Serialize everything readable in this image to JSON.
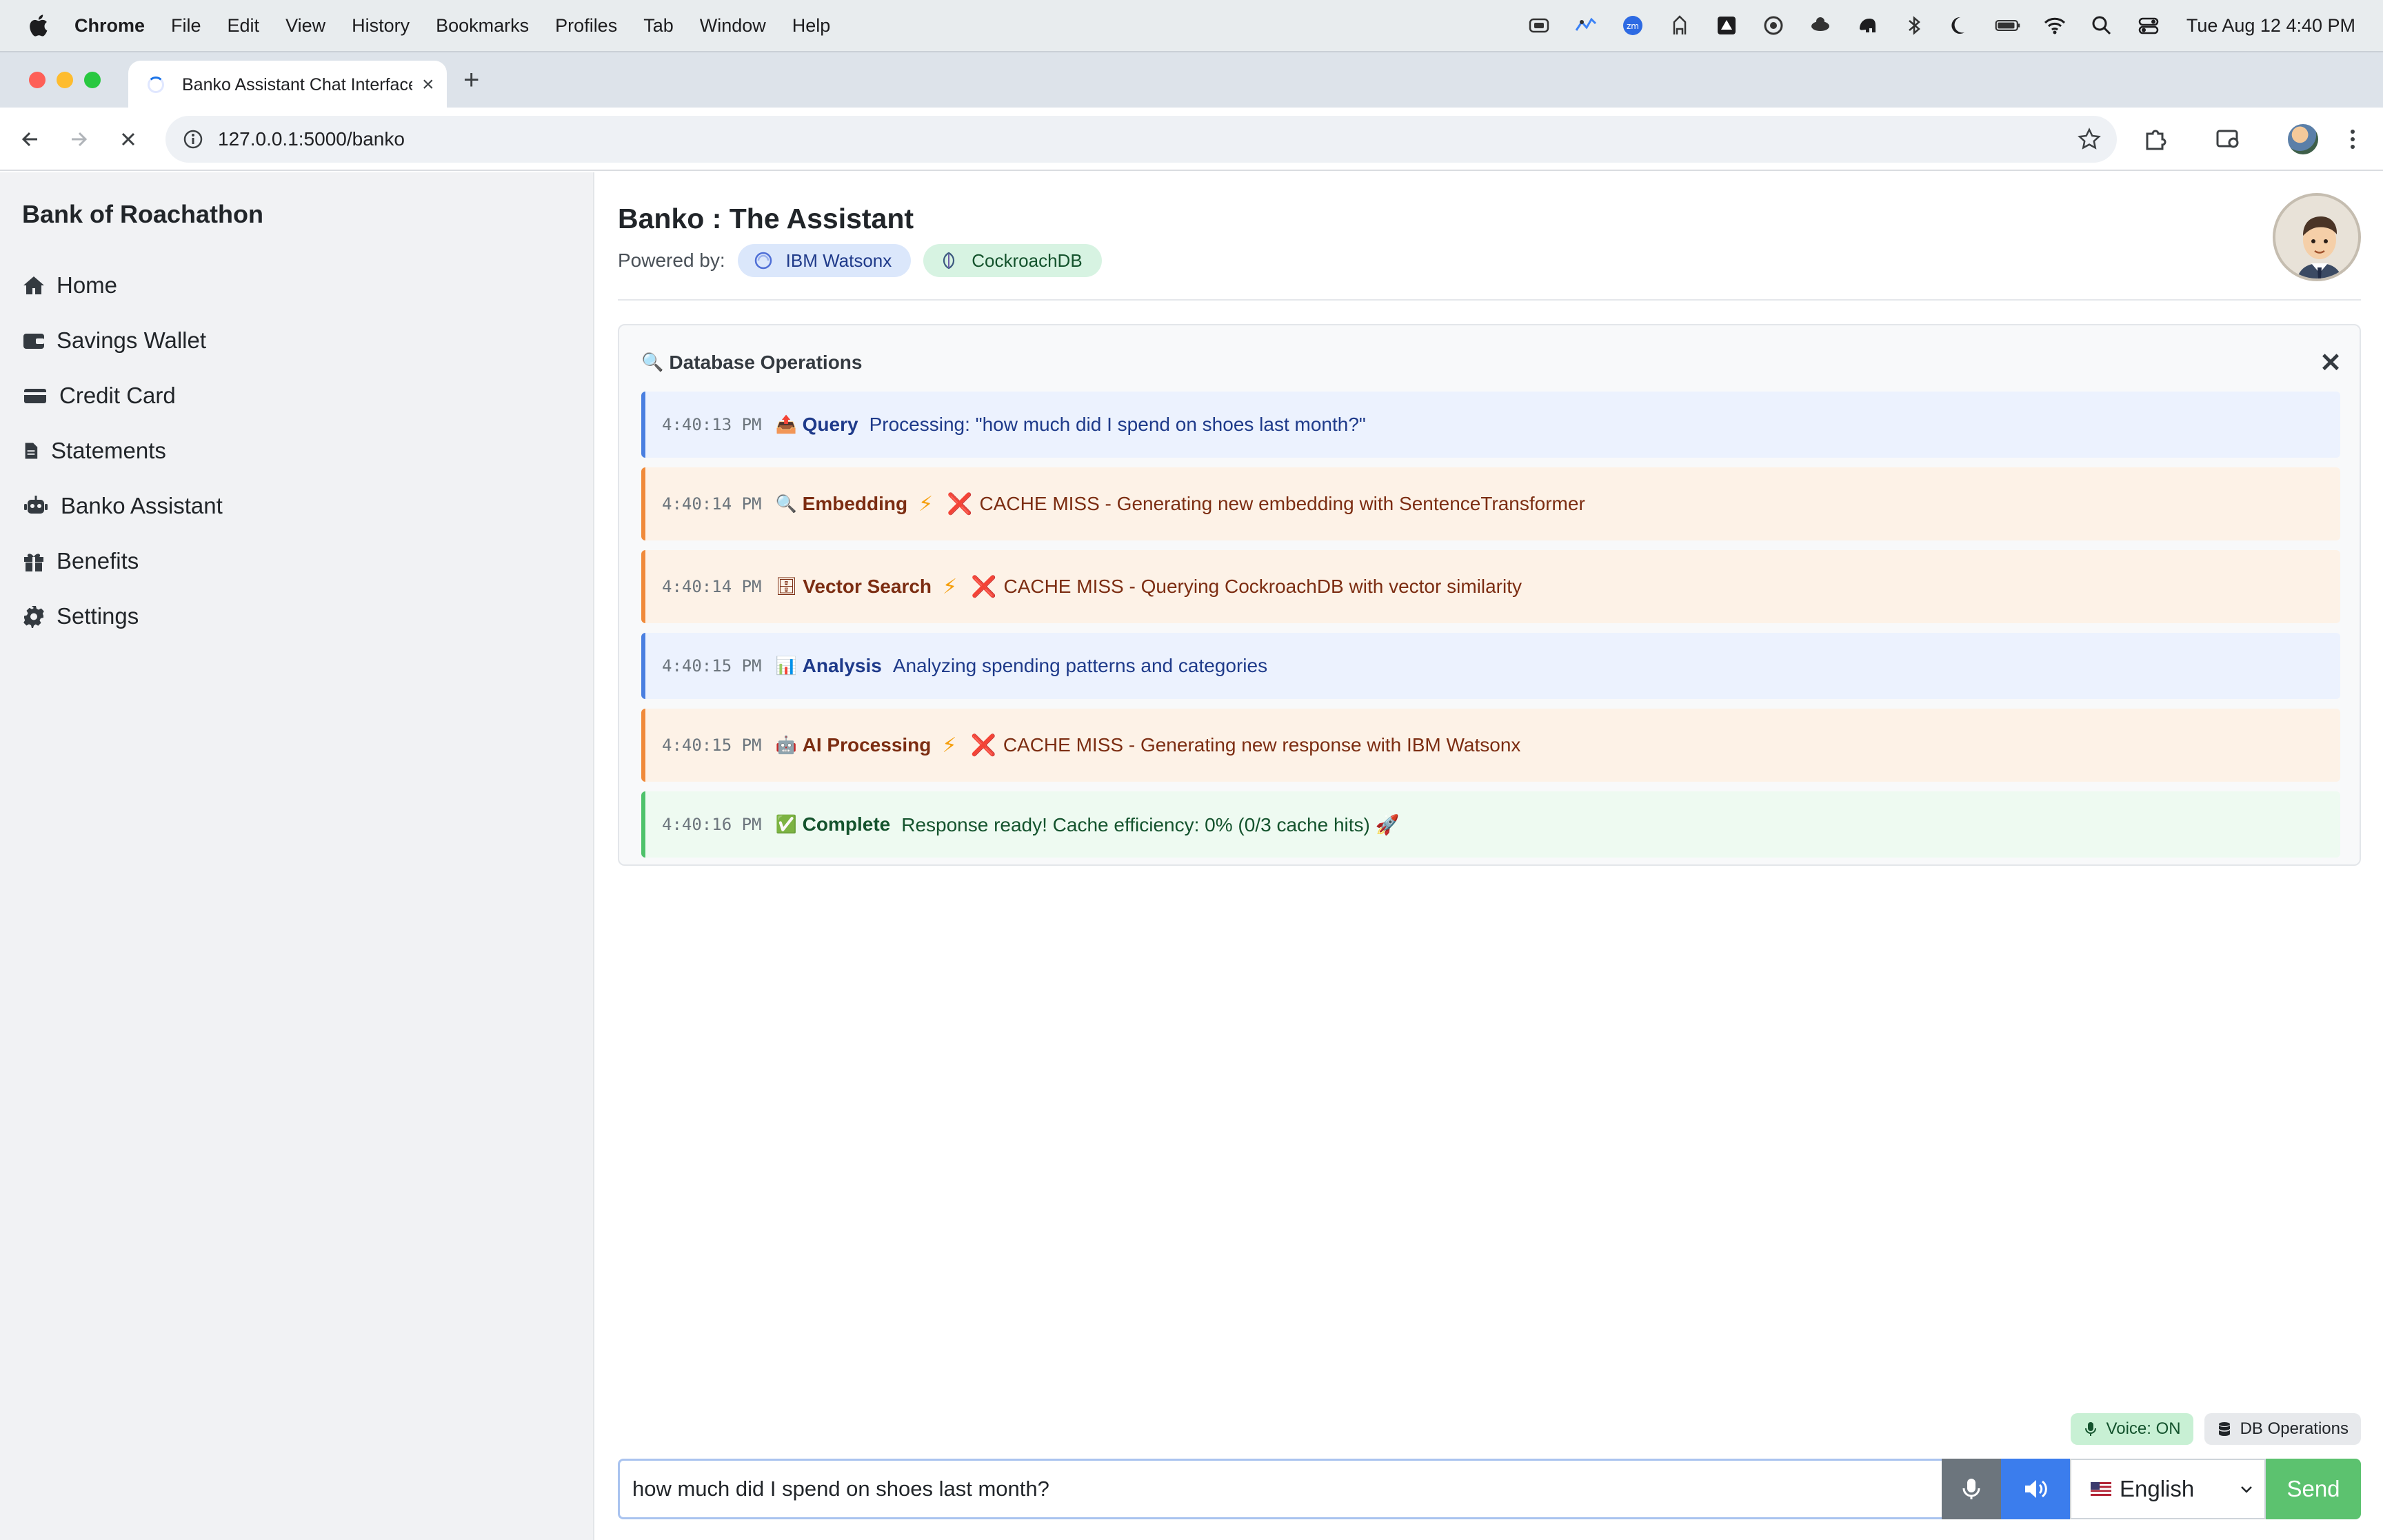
{
  "menubar": {
    "app": "Chrome",
    "items": [
      "File",
      "Edit",
      "View",
      "History",
      "Bookmarks",
      "Profiles",
      "Tab",
      "Window",
      "Help"
    ],
    "clock": "Tue Aug 12  4:40 PM"
  },
  "browser": {
    "tab_title": "Banko Assistant Chat Interface",
    "new_tab": "+",
    "url": "127.0.0.1:5000/banko"
  },
  "sidebar": {
    "brand": "Bank of Roachathon",
    "items": [
      {
        "label": "Home",
        "icon": "home-icon"
      },
      {
        "label": "Savings Wallet",
        "icon": "wallet-icon"
      },
      {
        "label": "Credit Card",
        "icon": "credit-card-icon"
      },
      {
        "label": "Statements",
        "icon": "document-icon"
      },
      {
        "label": "Banko Assistant",
        "icon": "robot-icon"
      },
      {
        "label": "Benefits",
        "icon": "gift-icon"
      },
      {
        "label": "Settings",
        "icon": "gear-icon"
      }
    ]
  },
  "header": {
    "title": "Banko : The Assistant",
    "powered_by": "Powered by:",
    "partners": [
      "IBM Watsonx",
      "CockroachDB"
    ]
  },
  "db_panel": {
    "title": "Database Operations",
    "title_icon": "magnifier-icon",
    "close": "✕",
    "operations": [
      {
        "time": "4:40:13 PM",
        "emoji": "📤",
        "label": "Query",
        "bolt": "",
        "x": "",
        "message": "Processing: \"how much did I spend on shoes last month?\"",
        "status": "info"
      },
      {
        "time": "4:40:14 PM",
        "emoji": "🔍",
        "label": "Embedding",
        "bolt": "⚡",
        "x": "❌",
        "message": "CACHE MISS - Generating new embedding with SentenceTransformer",
        "status": "warning"
      },
      {
        "time": "4:40:14 PM",
        "emoji": "🗄",
        "label": "Vector Search",
        "bolt": "⚡",
        "x": "❌",
        "message": "CACHE MISS - Querying CockroachDB with vector similarity",
        "status": "warning"
      },
      {
        "time": "4:40:15 PM",
        "emoji": "📊",
        "label": "Analysis",
        "bolt": "",
        "x": "",
        "message": "Analyzing spending patterns and categories",
        "status": "info"
      },
      {
        "time": "4:40:15 PM",
        "emoji": "🤖",
        "label": "AI Processing",
        "bolt": "⚡",
        "x": "❌",
        "message": "CACHE MISS - Generating new response with IBM Watsonx",
        "status": "warning"
      },
      {
        "time": "4:40:16 PM",
        "emoji": "✅",
        "label": "Complete",
        "bolt": "",
        "x": "",
        "message": "Response ready! Cache efficiency: 0% (0/3 cache hits) 🚀",
        "status": "success"
      }
    ]
  },
  "controls": {
    "voice_badge": "Voice: ON",
    "db_badge": "DB Operations"
  },
  "chat": {
    "input_value": "how much did I spend on shoes last month?",
    "language": "English",
    "send": "Send"
  },
  "colors": {
    "info_border": "#4a7fe0",
    "warning_border": "#f08a3a",
    "success_border": "#4ec26a",
    "send_button": "#5cc26f",
    "speaker_button": "#3b7ded"
  }
}
